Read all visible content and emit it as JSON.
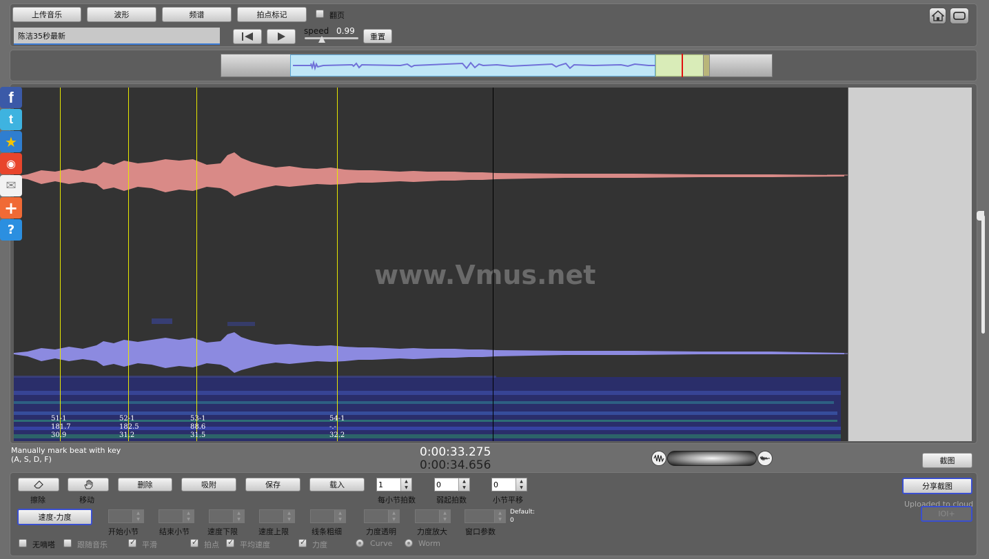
{
  "toolbar": {
    "upload": "上传音乐",
    "waveform": "波形",
    "spectrum": "频谱",
    "beat_mark": "拍点标记",
    "page_flip": "翻页"
  },
  "track": {
    "title": "陈洁35秒最新"
  },
  "playback": {
    "speed_label": "speed",
    "speed_value": "0.99",
    "reset": "重置"
  },
  "beats": [
    {
      "label": "51-1",
      "tempo": "181.7",
      "dyn": "30.9"
    },
    {
      "label": "52-1",
      "tempo": "182.5",
      "dyn": "31.2"
    },
    {
      "label": "53-1",
      "tempo": "88.6",
      "dyn": "31.5"
    },
    {
      "label": "54-1",
      "tempo": "-.-",
      "dyn": "32.2"
    }
  ],
  "watermark": "www.Vmus.net",
  "hint": {
    "line1": "Manually mark beat with key",
    "line2": "(A, S, D, F)"
  },
  "time": {
    "current": "0:00:33.275",
    "total": "0:00:34.656"
  },
  "screenshot_btn": "截图",
  "edit": {
    "erase": "擦除",
    "move": "移动",
    "delete": "删除",
    "snap": "吸附",
    "save": "保存",
    "load": "载入"
  },
  "params": {
    "beats_per_bar": {
      "label": "每小节拍数",
      "value": "1"
    },
    "pickup": {
      "label": "弱起拍数",
      "value": "0"
    },
    "bar_shift": {
      "label": "小节平移",
      "value": "0"
    }
  },
  "share": {
    "share_btn": "分享截图",
    "uploaded": "Uploaded to cloud",
    "ioi": "IOI+"
  },
  "mode_btn": "速度-力度",
  "lower_params": {
    "start_bar": "开始小节",
    "end_bar": "结束小节",
    "tempo_min": "速度下限",
    "tempo_max": "速度上限",
    "line_width": "线条粗细",
    "dyn_alpha": "力度透明",
    "dyn_scale": "力度放大",
    "window": "窗口参数",
    "default_label": "Default:",
    "default_value": "0"
  },
  "options": {
    "no_click": "无嘀嗒",
    "follow_music": "跟随音乐",
    "smooth": "平滑",
    "beat": "拍点",
    "avg_tempo": "平均速度",
    "dynamics": "力度",
    "curve": "Curve",
    "worm": "Worm"
  }
}
